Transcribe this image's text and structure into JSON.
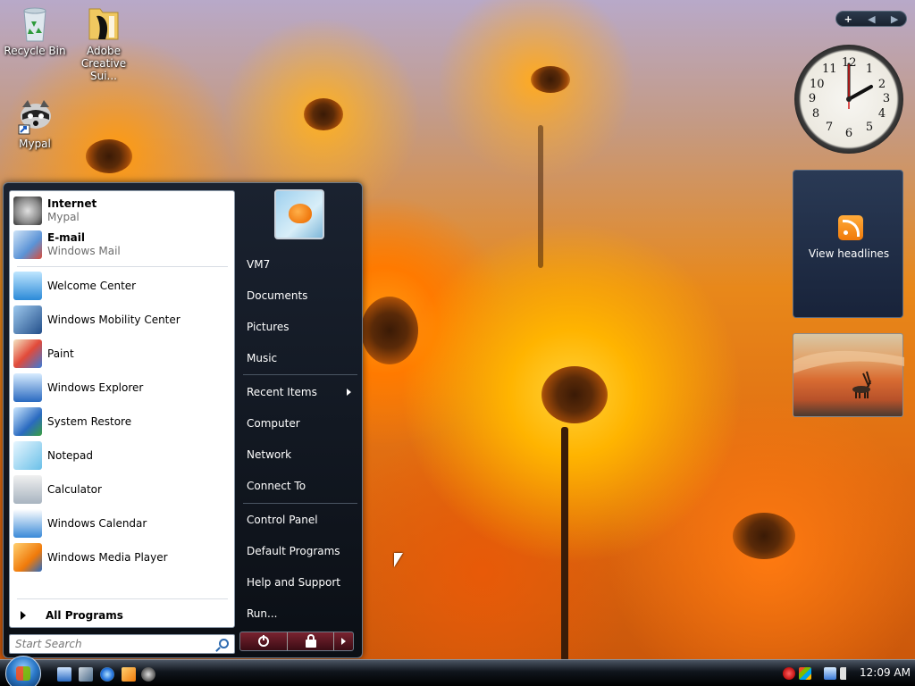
{
  "desktop": {
    "icons": [
      {
        "label": "Recycle Bin",
        "icon": "recycle-bin-icon"
      },
      {
        "label": "Adobe Creative Sui...",
        "icon": "folder-icon"
      },
      {
        "label": "Mypal",
        "icon": "mypal-icon"
      }
    ]
  },
  "start_menu": {
    "pinned": [
      {
        "name": "Internet",
        "sub": "Mypal",
        "icon": "mypal-icon"
      },
      {
        "name": "E-mail",
        "sub": "Windows Mail",
        "icon": "mail-icon"
      }
    ],
    "recent": [
      {
        "name": "Welcome Center",
        "icon": "welcome-center-icon"
      },
      {
        "name": "Windows Mobility Center",
        "icon": "mobility-center-icon"
      },
      {
        "name": "Paint",
        "icon": "paint-icon"
      },
      {
        "name": "Windows Explorer",
        "icon": "explorer-icon"
      },
      {
        "name": "System Restore",
        "icon": "system-restore-icon"
      },
      {
        "name": "Notepad",
        "icon": "notepad-icon"
      },
      {
        "name": "Calculator",
        "icon": "calculator-icon"
      },
      {
        "name": "Windows Calendar",
        "icon": "calendar-icon"
      },
      {
        "name": "Windows Media Player",
        "icon": "media-player-icon"
      }
    ],
    "all_programs": "All Programs",
    "search_placeholder": "Start Search",
    "right_items": [
      {
        "label": "VM7"
      },
      {
        "label": "Documents"
      },
      {
        "label": "Pictures"
      },
      {
        "label": "Music"
      },
      {
        "label": "Recent Items",
        "submenu": true
      },
      {
        "label": "Computer"
      },
      {
        "label": "Network"
      },
      {
        "label": "Connect To"
      },
      {
        "label": "Control Panel"
      },
      {
        "label": "Default Programs"
      },
      {
        "label": "Help and Support"
      },
      {
        "label": "Run..."
      }
    ]
  },
  "sidebar": {
    "clock_numbers": [
      "12",
      "1",
      "2",
      "3",
      "4",
      "5",
      "6",
      "7",
      "8",
      "9",
      "10",
      "11"
    ],
    "headlines_label": "View headlines"
  },
  "taskbar": {
    "time": "12:09 AM"
  }
}
